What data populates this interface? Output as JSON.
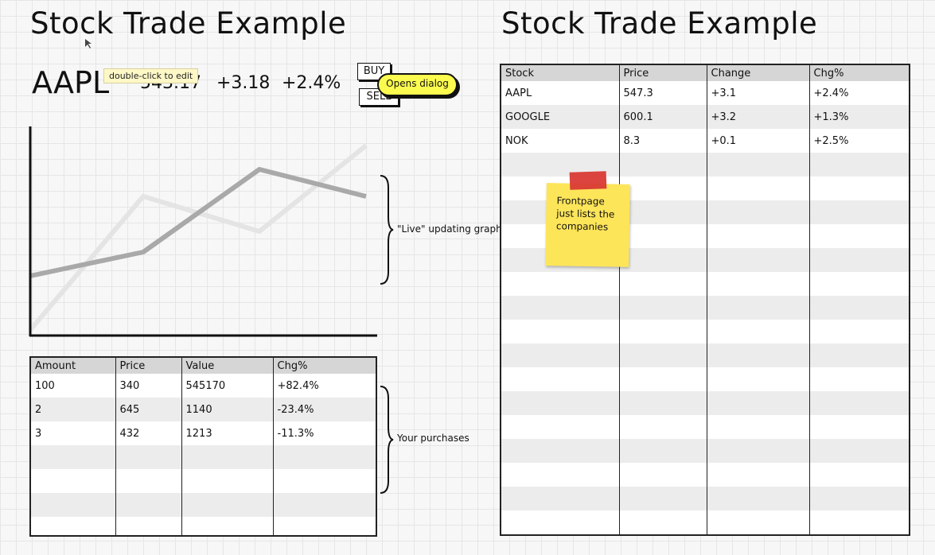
{
  "left": {
    "title": "Stock Trade Example",
    "quote": {
      "ticker": "AAPL",
      "price": "543.17",
      "change": "+3.18",
      "change_pct": "+2.4%"
    },
    "tooltip": "double-click to edit",
    "buttons": {
      "buy": "BUY",
      "sell": "SELL"
    },
    "callout": "Opens dialog",
    "graph_note": "\"Live\" updating graph",
    "purchases_note": "Your purchases",
    "purchases": {
      "columns": [
        "Amount",
        "Price",
        "Value",
        "Chg%"
      ],
      "rows": [
        [
          "100",
          "340",
          "545170",
          "+82.4%"
        ],
        [
          "2",
          "645",
          "1140",
          "-23.4%"
        ],
        [
          "3",
          "432",
          "1213",
          "-11.3%"
        ]
      ],
      "empty_rows": 4
    }
  },
  "right": {
    "title": "Stock Trade Example",
    "stocks": {
      "columns": [
        "Stock",
        "Price",
        "Change",
        "Chg%"
      ],
      "rows": [
        [
          "AAPL",
          "547.3",
          "+3.1",
          "+2.4%"
        ],
        [
          "GOOGLE",
          "600.1",
          "+3.2",
          "+1.3%"
        ],
        [
          "NOK",
          "8.3",
          "+0.1",
          "+2.5%"
        ]
      ],
      "empty_rows": 16
    },
    "sticky_note": "Frontpage just lists the companies"
  },
  "colors": {
    "callout": "#fbfb4f",
    "sticky": "#fde55a",
    "tape": "#d93a35",
    "series_dark": "#a9a9a9",
    "series_light": "#e4e4e4"
  }
}
